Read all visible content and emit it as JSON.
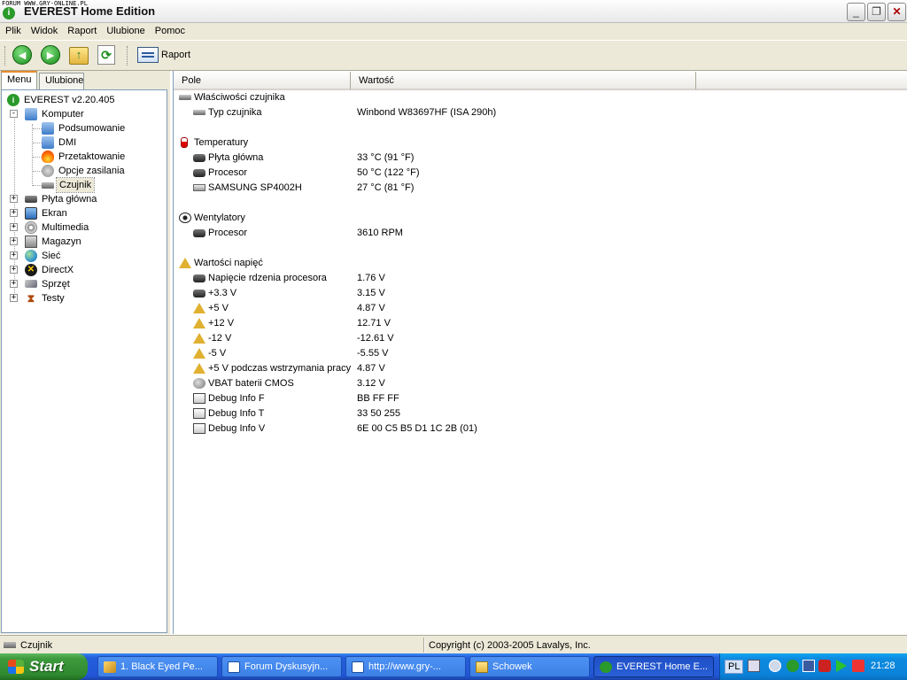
{
  "window": {
    "watermark": "FORUM WWW.GRY-ONLINE.PL",
    "title": "EVEREST Home Edition"
  },
  "menubar": [
    "Plik",
    "Widok",
    "Raport",
    "Ulubione",
    "Pomoc"
  ],
  "toolbar": {
    "report_label": "Raport"
  },
  "left": {
    "tabs": [
      "Menu",
      "Ulubione"
    ],
    "root": "EVEREST v2.20.405",
    "computer": "Komputer",
    "computer_children": [
      "Podsumowanie",
      "DMI",
      "Przetaktowanie",
      "Opcje zasilania",
      "Czujnik"
    ],
    "top_items": [
      "Płyta główna",
      "Ekran",
      "Multimedia",
      "Magazyn",
      "Sieć",
      "DirectX",
      "Sprzęt",
      "Testy"
    ]
  },
  "right": {
    "columns": [
      "Pole",
      "Wartość"
    ],
    "rows": [
      {
        "label": "Właściwości czujnika",
        "value": "",
        "section": true
      },
      {
        "label": "Typ czujnika",
        "value": "Winbond W83697HF  (ISA 290h)",
        "section": false
      },
      {
        "label": "Temperatury",
        "value": "",
        "section": true
      },
      {
        "label": "Płyta główna",
        "value": "33 °C  (91 °F)",
        "section": false
      },
      {
        "label": "Procesor",
        "value": "50 °C  (122 °F)",
        "section": false
      },
      {
        "label": "SAMSUNG SP4002H",
        "value": "27 °C  (81 °F)",
        "section": false
      },
      {
        "label": "Wentylatory",
        "value": "",
        "section": true
      },
      {
        "label": "Procesor",
        "value": "3610 RPM",
        "section": false
      },
      {
        "label": "Wartości napięć",
        "value": "",
        "section": true
      },
      {
        "label": "Napięcie rdzenia procesora",
        "value": "1.76 V",
        "section": false
      },
      {
        "label": "+3.3 V",
        "value": "3.15 V",
        "section": false
      },
      {
        "label": "+5 V",
        "value": "4.87 V",
        "section": false
      },
      {
        "label": "+12 V",
        "value": "12.71 V",
        "section": false
      },
      {
        "label": "-12 V",
        "value": "-12.61 V",
        "section": false
      },
      {
        "label": "-5 V",
        "value": "-5.55 V",
        "section": false
      },
      {
        "label": "+5 V podczas wstrzymania pracy",
        "value": "4.87 V",
        "section": false
      },
      {
        "label": "VBAT baterii CMOS",
        "value": "3.12 V",
        "section": false
      },
      {
        "label": "Debug Info F",
        "value": "BB FF FF",
        "section": false
      },
      {
        "label": "Debug Info T",
        "value": "33 50 255",
        "section": false
      },
      {
        "label": "Debug Info V",
        "value": "6E 00 C5 B5 D1 1C 2B (01)",
        "section": false
      }
    ]
  },
  "status": {
    "left": "Czujnik",
    "right": "Copyright (c) 2003-2005 Lavalys, Inc."
  },
  "taskbar": {
    "start": "Start",
    "tasks": [
      "1. Black Eyed Pe...",
      "Forum Dyskusyjn...",
      "http://www.gry-...",
      "Schowek",
      "EVEREST Home E..."
    ],
    "lang": "PL",
    "clock": "21:28"
  }
}
